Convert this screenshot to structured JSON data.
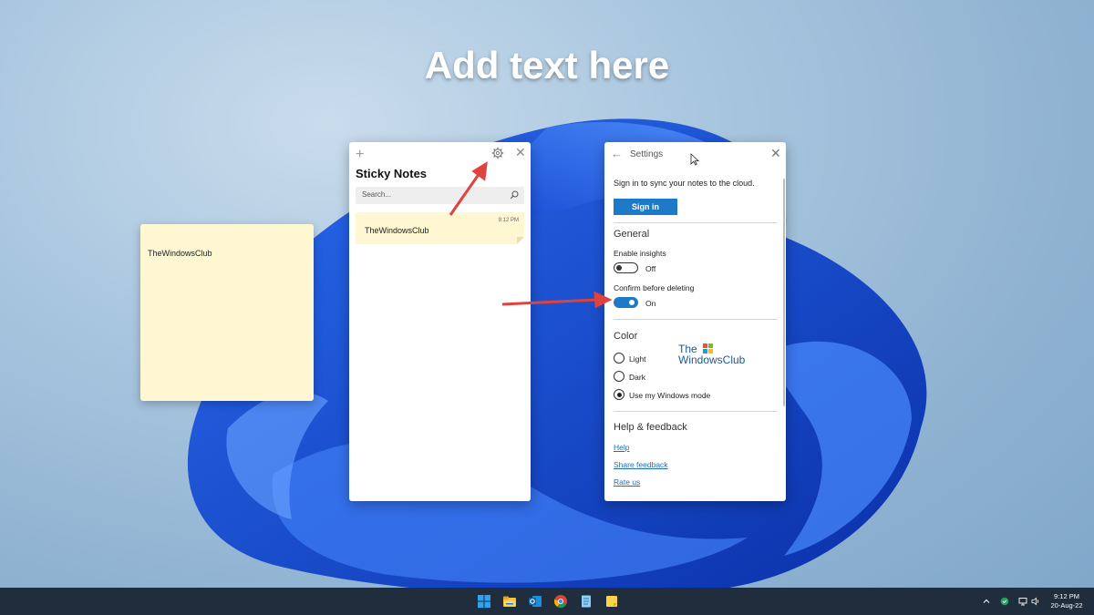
{
  "headline": "Add text here",
  "sticky_note": {
    "text": "TheWindowsClub"
  },
  "notes_window": {
    "add_icon": "plus-icon",
    "settings_icon": "gear-icon",
    "close_icon": "close-icon",
    "title": "Sticky Notes",
    "search_placeholder": "Search...",
    "search_icon": "search-icon",
    "notes": [
      {
        "time": "9:12 PM",
        "title": "TheWindowsClub"
      }
    ]
  },
  "settings_window": {
    "back_icon": "back-arrow-icon",
    "title": "Settings",
    "close_icon": "close-icon",
    "sync_text": "Sign in to sync your notes to the cloud.",
    "signin_label": "Sign in",
    "general": {
      "heading": "General",
      "insights_label": "Enable insights",
      "insights_state": "Off",
      "confirm_label": "Confirm before deleting",
      "confirm_state": "On"
    },
    "color": {
      "heading": "Color",
      "options": [
        "Light",
        "Dark",
        "Use my Windows mode"
      ],
      "selected": "Use my Windows mode"
    },
    "help": {
      "heading": "Help & feedback",
      "links": [
        "Help",
        "Share feedback",
        "Rate us"
      ]
    }
  },
  "watermark": {
    "line1": "The",
    "line2": "WindowsClub"
  },
  "taskbar": {
    "apps": [
      "start-icon",
      "file-explorer-icon",
      "outlook-icon",
      "chrome-icon",
      "notepad-icon",
      "sticky-notes-icon"
    ],
    "tray": [
      "chevron-up-icon",
      "security-icon",
      "network-icon",
      "volume-icon"
    ],
    "time": "9:12 PM",
    "date": "20-Aug-22"
  },
  "colors": {
    "accent": "#1e7ac8",
    "note_yellow": "#fff7d1",
    "taskbar": "#1f2d3d",
    "arrow": "#e0423e"
  }
}
